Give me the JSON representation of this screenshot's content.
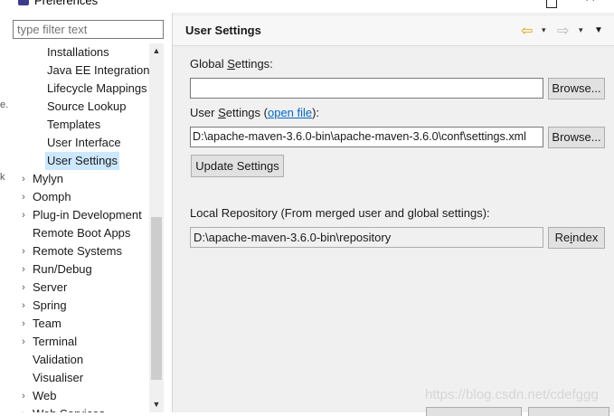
{
  "window": {
    "title": "Preferences",
    "minimize_symbol": "",
    "close_symbol": "✕"
  },
  "left_edge_fragments": [
    "e.",
    "k"
  ],
  "filter": {
    "placeholder": "type filter text"
  },
  "tree": {
    "items": [
      {
        "label": "Installations",
        "level": 2,
        "expandable": false
      },
      {
        "label": "Java EE Integration",
        "level": 2,
        "expandable": false
      },
      {
        "label": "Lifecycle Mappings",
        "level": 2,
        "expandable": false
      },
      {
        "label": "Source Lookup",
        "level": 2,
        "expandable": false
      },
      {
        "label": "Templates",
        "level": 2,
        "expandable": false
      },
      {
        "label": "User Interface",
        "level": 2,
        "expandable": false
      },
      {
        "label": "User Settings",
        "level": 2,
        "expandable": false,
        "selected": true
      },
      {
        "label": "Mylyn",
        "level": 1,
        "expandable": true
      },
      {
        "label": "Oomph",
        "level": 1,
        "expandable": true
      },
      {
        "label": "Plug-in Development",
        "level": 1,
        "expandable": true
      },
      {
        "label": "Remote Boot Apps",
        "level": 1,
        "expandable": false
      },
      {
        "label": "Remote Systems",
        "level": 1,
        "expandable": true
      },
      {
        "label": "Run/Debug",
        "level": 1,
        "expandable": true
      },
      {
        "label": "Server",
        "level": 1,
        "expandable": true
      },
      {
        "label": "Spring",
        "level": 1,
        "expandable": true
      },
      {
        "label": "Team",
        "level": 1,
        "expandable": true
      },
      {
        "label": "Terminal",
        "level": 1,
        "expandable": true
      },
      {
        "label": "Validation",
        "level": 1,
        "expandable": false
      },
      {
        "label": "Visualiser",
        "level": 1,
        "expandable": false
      },
      {
        "label": "Web",
        "level": 1,
        "expandable": true
      },
      {
        "label": "Web Services",
        "level": 1,
        "expandable": true
      }
    ],
    "twisty_symbol": "›"
  },
  "page": {
    "title": "User Settings",
    "nav_back_symbol": "⇦",
    "nav_fwd_symbol": "⇨",
    "dropdown_symbol": "▾",
    "view_menu_symbol": "▼"
  },
  "global_settings": {
    "label_prefix": "Global ",
    "label_mnemonic": "S",
    "label_suffix": "ettings:",
    "value": "",
    "browse_label": "Browse..."
  },
  "user_settings": {
    "label_prefix": "User ",
    "label_mnemonic": "S",
    "label_suffix": "ettings (",
    "link_text": "open file",
    "label_end": "):",
    "value": "D:\\apache-maven-3.6.0-bin\\apache-maven-3.6.0\\conf\\settings.xml",
    "browse_label": "Browse...",
    "update_label": "Update Settings"
  },
  "local_repository": {
    "label": "Local Repository (From merged user and global settings):",
    "value": "D:\\apache-maven-3.6.0-bin\\repository",
    "reindex_prefix": "Re",
    "reindex_mnemonic": "i",
    "reindex_suffix": "ndex"
  },
  "watermark": "https://blog.csdn.net/cdefggg"
}
